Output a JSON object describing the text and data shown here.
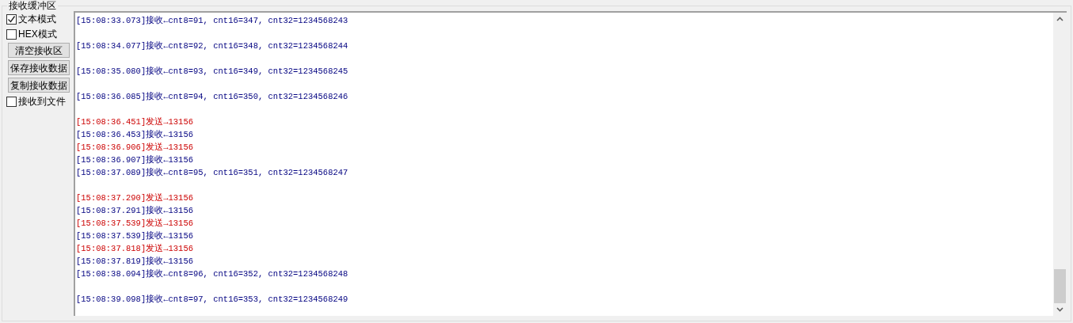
{
  "group_title": "接收缓冲区",
  "controls": [
    {
      "kind": "checkbox",
      "label": "文本模式",
      "checked": true
    },
    {
      "kind": "checkbox",
      "label": "HEX模式",
      "checked": false
    },
    {
      "kind": "button",
      "label": "清空接收区"
    },
    {
      "kind": "button",
      "label": "保存接收数据"
    },
    {
      "kind": "button",
      "label": "复制接收数据"
    },
    {
      "kind": "checkbox",
      "label": "接收到文件",
      "checked": false
    }
  ],
  "log_blocks": [
    {
      "lines": [
        {
          "kind": "recv",
          "text": "[15:08:33.073]接收←cnt8=91, cnt16=347, cnt32=1234568243"
        }
      ]
    },
    {
      "lines": [
        {
          "kind": "recv",
          "text": "[15:08:34.077]接收←cnt8=92, cnt16=348, cnt32=1234568244"
        }
      ]
    },
    {
      "lines": [
        {
          "kind": "recv",
          "text": "[15:08:35.080]接收←cnt8=93, cnt16=349, cnt32=1234568245"
        }
      ]
    },
    {
      "lines": [
        {
          "kind": "recv",
          "text": "[15:08:36.085]接收←cnt8=94, cnt16=350, cnt32=1234568246"
        }
      ]
    },
    {
      "lines": [
        {
          "kind": "send",
          "text": "[15:08:36.451]发送→13156"
        },
        {
          "kind": "recv",
          "text": "[15:08:36.453]接收←13156"
        },
        {
          "kind": "send",
          "text": "[15:08:36.906]发送→13156"
        },
        {
          "kind": "recv",
          "text": "[15:08:36.907]接收←13156"
        },
        {
          "kind": "recv",
          "text": "[15:08:37.089]接收←cnt8=95, cnt16=351, cnt32=1234568247"
        }
      ]
    },
    {
      "lines": [
        {
          "kind": "send",
          "text": "[15:08:37.290]发送→13156"
        },
        {
          "kind": "recv",
          "text": "[15:08:37.291]接收←13156"
        },
        {
          "kind": "send",
          "text": "[15:08:37.539]发送→13156"
        },
        {
          "kind": "recv",
          "text": "[15:08:37.539]接收←13156"
        },
        {
          "kind": "send",
          "text": "[15:08:37.818]发送→13156"
        },
        {
          "kind": "recv",
          "text": "[15:08:37.819]接收←13156"
        },
        {
          "kind": "recv",
          "text": "[15:08:38.094]接收←cnt8=96, cnt16=352, cnt32=1234568248"
        }
      ]
    },
    {
      "lines": [
        {
          "kind": "recv",
          "text": "[15:08:39.098]接收←cnt8=97, cnt16=353, cnt32=1234568249"
        }
      ]
    }
  ]
}
